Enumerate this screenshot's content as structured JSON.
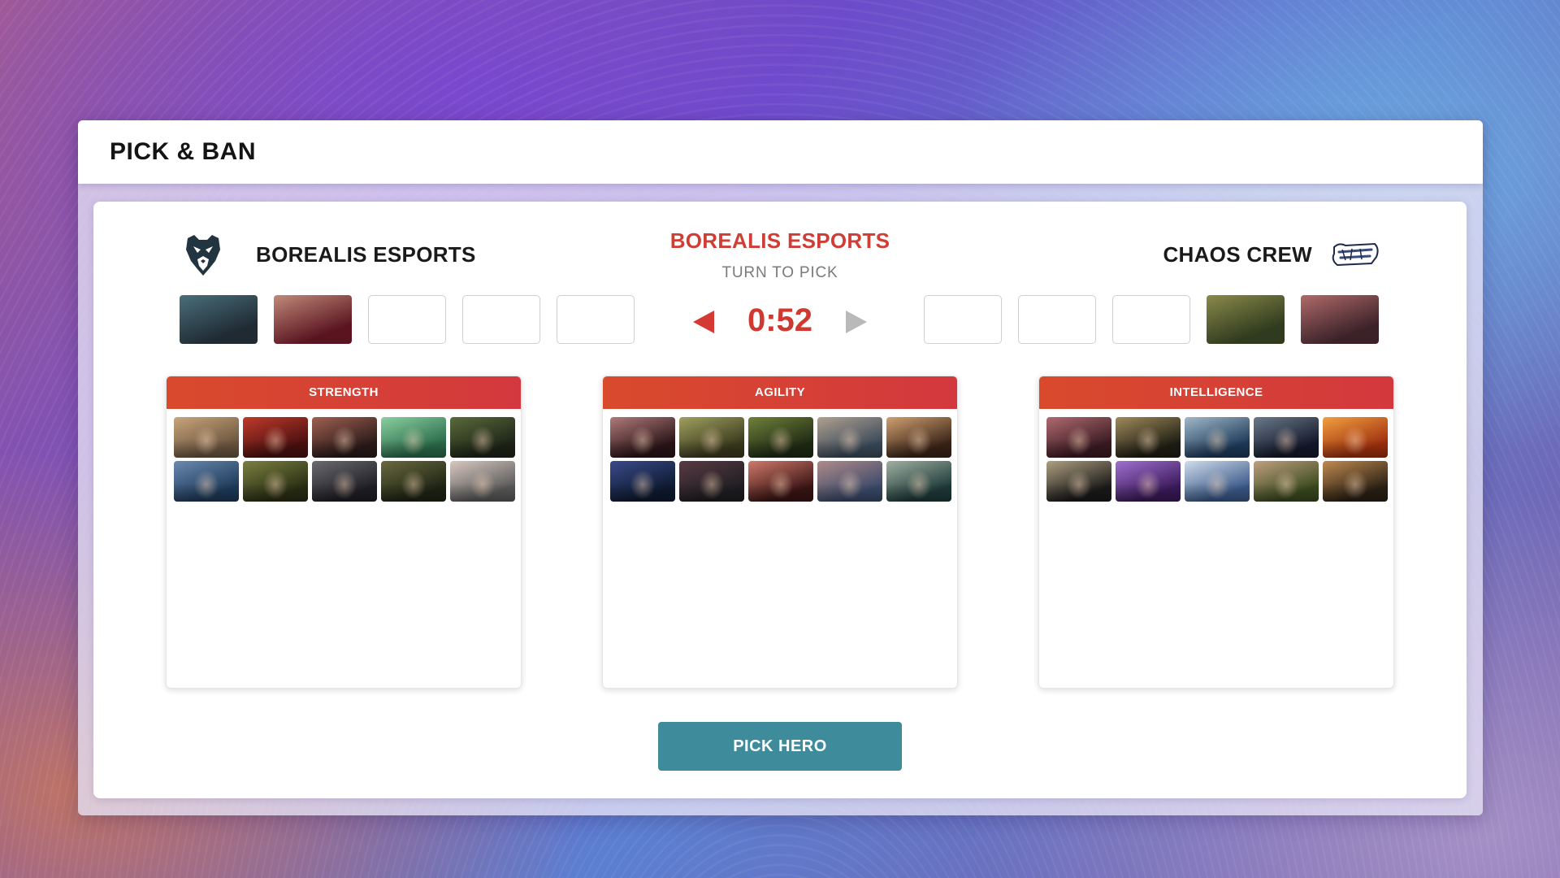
{
  "page": {
    "title": "PICK & BAN"
  },
  "teams": {
    "left": {
      "name": "BOREALIS ESPORTS",
      "logo_icon": "bear-logo-icon"
    },
    "right": {
      "name": "CHAOS CREW",
      "logo_icon": "chaos-crew-logo-icon",
      "logo_text": "CHAOS CREW"
    }
  },
  "turn": {
    "team": "BOREALIS ESPORTS",
    "label": "TURN TO PICK"
  },
  "timer": {
    "value": "0:52"
  },
  "slots": {
    "left": [
      {
        "filled": true,
        "colors": [
          "#1f2a33",
          "#4a6f7a"
        ]
      },
      {
        "filled": true,
        "colors": [
          "#5a1420",
          "#c08a7a"
        ]
      },
      {
        "filled": false
      },
      {
        "filled": false
      },
      {
        "filled": false
      }
    ],
    "right": [
      {
        "filled": false
      },
      {
        "filled": false
      },
      {
        "filled": false
      },
      {
        "filled": true,
        "colors": [
          "#2f3a1e",
          "#8a8a4a"
        ]
      },
      {
        "filled": true,
        "colors": [
          "#3a2228",
          "#b06a6a"
        ]
      }
    ]
  },
  "categories": [
    {
      "label": "STRENGTH",
      "heroes": [
        [
          "#6b5540",
          "#c9a57a"
        ],
        [
          "#4a1010",
          "#c03a2a"
        ],
        [
          "#2a1a1a",
          "#a06050"
        ],
        [
          "#2a6a4a",
          "#8ad0a0"
        ],
        [
          "#1e2418",
          "#5a6a3a"
        ],
        [
          "#1e3a5a",
          "#6a8ab0"
        ],
        [
          "#2a2e14",
          "#7a8040"
        ],
        [
          "#1e1e24",
          "#6a6a70"
        ],
        [
          "#1e2414",
          "#6a6a3e"
        ],
        [
          "#5a5a5a",
          "#d8c8c0"
        ]
      ]
    },
    {
      "label": "AGILITY",
      "heroes": [
        [
          "#2a1418",
          "#b07a7a"
        ],
        [
          "#3a3a1e",
          "#a0a060"
        ],
        [
          "#1e2a14",
          "#70803a"
        ],
        [
          "#3a4a5a",
          "#b0a090"
        ],
        [
          "#3a2418",
          "#d0a070"
        ],
        [
          "#0e1a30",
          "#3a4a8a"
        ],
        [
          "#1e1e22",
          "#5a3a44"
        ],
        [
          "#3a1414",
          "#d07a6a"
        ],
        [
          "#3a4a6a",
          "#b08a8a"
        ],
        [
          "#1e3a3a",
          "#a0b0a0"
        ]
      ]
    },
    {
      "label": "INTELLIGENCE",
      "heroes": [
        [
          "#3a1a22",
          "#b06a70"
        ],
        [
          "#1e1e14",
          "#a08a5a"
        ],
        [
          "#1e3a5a",
          "#a0b8c8"
        ],
        [
          "#14182a",
          "#6a7a8a"
        ],
        [
          "#a0300e",
          "#f0a040"
        ],
        [
          "#1a1a1a",
          "#b0a080"
        ],
        [
          "#3a1a5a",
          "#a070d0"
        ],
        [
          "#3a5a8a",
          "#d0dcea"
        ],
        [
          "#3a4a1e",
          "#c0a080"
        ],
        [
          "#2a2014",
          "#c08a50"
        ]
      ]
    }
  ],
  "actions": {
    "pick_label": "PICK HERO"
  }
}
